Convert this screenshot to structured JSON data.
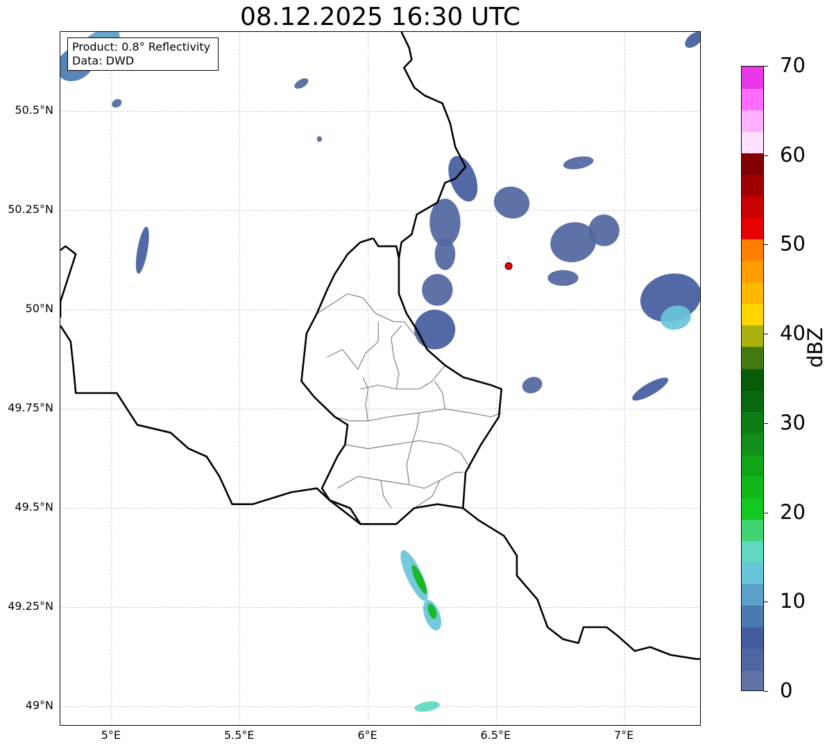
{
  "title": "08.12.2025 16:30 UTC",
  "info_box": {
    "product": "Product: 0.8° Reflectivity",
    "source": "Data: DWD"
  },
  "map": {
    "extent": {
      "lon_min": 4.8,
      "lon_max": 7.3,
      "lat_min": 48.95,
      "lat_max": 50.7
    },
    "gridlines": true,
    "lat_ticks": [
      {
        "value": 50.5,
        "label": "50.5°N"
      },
      {
        "value": 50.25,
        "label": "50.25°N"
      },
      {
        "value": 50.0,
        "label": "50°N"
      },
      {
        "value": 49.75,
        "label": "49.75°N"
      },
      {
        "value": 49.5,
        "label": "49.5°N"
      },
      {
        "value": 49.25,
        "label": "49.25°N"
      },
      {
        "value": 49.0,
        "label": "49°N"
      }
    ],
    "lon_ticks": [
      {
        "value": 5.0,
        "label": "5°E"
      },
      {
        "value": 5.5,
        "label": "5.5°E"
      },
      {
        "value": 6.0,
        "label": "6°E"
      },
      {
        "value": 6.5,
        "label": "6.5°E"
      },
      {
        "value": 7.0,
        "label": "7°E"
      }
    ],
    "radar_site": {
      "lon": 6.548,
      "lat": 50.11,
      "marker_color": "#ee0000"
    },
    "national_borders": [
      [
        [
          6.13,
          50.7
        ],
        [
          6.16,
          50.66
        ],
        [
          6.17,
          50.63
        ],
        [
          6.14,
          50.61
        ],
        [
          6.18,
          50.56
        ],
        [
          6.22,
          50.54
        ],
        [
          6.29,
          50.52
        ],
        [
          6.32,
          50.47
        ],
        [
          6.34,
          50.41
        ],
        [
          6.38,
          50.36
        ],
        [
          6.34,
          50.33
        ],
        [
          6.3,
          50.32
        ],
        [
          6.27,
          50.27
        ],
        [
          6.19,
          50.24
        ],
        [
          6.17,
          50.19
        ],
        [
          6.13,
          50.17
        ],
        [
          6.12,
          50.13
        ],
        [
          6.12,
          50.08
        ],
        [
          6.12,
          50.04
        ],
        [
          6.15,
          49.99
        ],
        [
          6.19,
          49.95
        ],
        [
          6.23,
          49.9
        ],
        [
          6.3,
          49.86
        ],
        [
          6.37,
          49.83
        ],
        [
          6.48,
          49.81
        ],
        [
          6.52,
          49.8
        ],
        [
          6.51,
          49.73
        ],
        [
          6.44,
          49.66
        ],
        [
          6.38,
          49.59
        ],
        [
          6.37,
          49.5
        ],
        [
          6.43,
          49.47
        ],
        [
          6.53,
          49.43
        ],
        [
          6.58,
          49.38
        ],
        [
          6.58,
          49.33
        ],
        [
          6.66,
          49.27
        ],
        [
          6.7,
          49.2
        ],
        [
          6.76,
          49.17
        ],
        [
          6.82,
          49.16
        ],
        [
          6.84,
          49.2
        ],
        [
          6.93,
          49.2
        ],
        [
          6.97,
          49.18
        ],
        [
          7.04,
          49.14
        ],
        [
          7.1,
          49.15
        ],
        [
          7.18,
          49.13
        ],
        [
          7.28,
          49.12
        ],
        [
          7.3,
          49.12
        ]
      ],
      [
        [
          6.37,
          49.5
        ],
        [
          6.27,
          49.51
        ],
        [
          6.18,
          49.5
        ],
        [
          6.11,
          49.46
        ],
        [
          5.97,
          49.46
        ],
        [
          5.93,
          49.5
        ],
        [
          5.85,
          49.52
        ],
        [
          5.8,
          49.55
        ],
        [
          5.7,
          49.54
        ],
        [
          5.55,
          49.51
        ],
        [
          5.47,
          49.51
        ],
        [
          5.42,
          49.58
        ],
        [
          5.37,
          49.63
        ],
        [
          5.3,
          49.65
        ],
        [
          5.23,
          49.69
        ],
        [
          5.1,
          49.71
        ],
        [
          5.02,
          49.79
        ],
        [
          4.92,
          49.79
        ],
        [
          4.86,
          49.79
        ],
        [
          4.85,
          49.86
        ],
        [
          4.84,
          49.92
        ],
        [
          4.8,
          49.96
        ]
      ],
      [
        [
          4.8,
          50.15
        ],
        [
          4.82,
          50.16
        ],
        [
          4.86,
          50.14
        ],
        [
          4.83,
          50.08
        ],
        [
          4.8,
          50.02
        ],
        [
          4.8,
          49.98
        ]
      ],
      [
        [
          6.02,
          50.18
        ],
        [
          5.97,
          50.17
        ],
        [
          5.92,
          50.14
        ],
        [
          5.87,
          50.09
        ],
        [
          5.84,
          50.05
        ],
        [
          5.8,
          49.99
        ],
        [
          5.76,
          49.94
        ],
        [
          5.75,
          49.88
        ],
        [
          5.74,
          49.82
        ],
        [
          5.79,
          49.78
        ],
        [
          5.87,
          49.73
        ],
        [
          5.92,
          49.71
        ],
        [
          5.91,
          49.66
        ],
        [
          5.88,
          49.63
        ],
        [
          5.82,
          49.55
        ],
        [
          5.85,
          49.52
        ],
        [
          5.97,
          49.46
        ]
      ],
      [
        [
          6.02,
          50.18
        ],
        [
          6.04,
          50.16
        ],
        [
          6.11,
          50.16
        ],
        [
          6.12,
          50.13
        ]
      ]
    ],
    "district_borders": [
      [
        [
          5.8,
          49.99
        ],
        [
          5.92,
          50.04
        ],
        [
          5.98,
          50.03
        ],
        [
          6.03,
          49.99
        ],
        [
          6.1,
          49.97
        ],
        [
          6.14,
          49.97
        ],
        [
          6.19,
          49.93
        ]
      ],
      [
        [
          5.84,
          49.88
        ],
        [
          5.9,
          49.9
        ],
        [
          5.96,
          49.85
        ],
        [
          5.99,
          49.89
        ],
        [
          6.04,
          49.92
        ],
        [
          6.04,
          49.97
        ]
      ],
      [
        [
          5.97,
          49.8
        ],
        [
          6.04,
          49.81
        ],
        [
          6.11,
          49.8
        ],
        [
          6.2,
          49.8
        ],
        [
          6.25,
          49.82
        ],
        [
          6.3,
          49.86
        ]
      ],
      [
        [
          5.87,
          49.73
        ],
        [
          5.93,
          49.72
        ],
        [
          6.0,
          49.72
        ],
        [
          6.08,
          49.73
        ],
        [
          6.2,
          49.74
        ],
        [
          6.3,
          49.75
        ],
        [
          6.4,
          49.74
        ],
        [
          6.48,
          49.73
        ],
        [
          6.52,
          49.74
        ]
      ],
      [
        [
          5.91,
          49.66
        ],
        [
          6.0,
          49.65
        ],
        [
          6.1,
          49.66
        ],
        [
          6.2,
          49.67
        ],
        [
          6.3,
          49.66
        ],
        [
          6.36,
          49.64
        ],
        [
          6.4,
          49.6
        ]
      ],
      [
        [
          5.88,
          49.55
        ],
        [
          5.96,
          49.58
        ],
        [
          6.05,
          49.57
        ],
        [
          6.15,
          49.56
        ],
        [
          6.22,
          49.55
        ],
        [
          6.28,
          49.57
        ],
        [
          6.34,
          49.59
        ],
        [
          6.37,
          49.59
        ]
      ],
      [
        [
          6.0,
          49.72
        ],
        [
          5.99,
          49.76
        ],
        [
          6.0,
          49.8
        ],
        [
          5.98,
          49.83
        ]
      ],
      [
        [
          6.11,
          49.8
        ],
        [
          6.12,
          49.84
        ],
        [
          6.1,
          49.88
        ],
        [
          6.09,
          49.93
        ],
        [
          6.13,
          49.96
        ]
      ],
      [
        [
          6.2,
          49.74
        ],
        [
          6.19,
          49.7
        ],
        [
          6.17,
          49.66
        ],
        [
          6.15,
          49.61
        ],
        [
          6.16,
          49.56
        ]
      ],
      [
        [
          6.3,
          49.75
        ],
        [
          6.29,
          49.79
        ],
        [
          6.26,
          49.82
        ]
      ],
      [
        [
          6.05,
          49.57
        ],
        [
          6.06,
          49.53
        ],
        [
          6.09,
          49.5
        ]
      ],
      [
        [
          6.28,
          49.57
        ],
        [
          6.25,
          49.53
        ],
        [
          6.18,
          49.5
        ]
      ]
    ],
    "echoes": [
      {
        "lon": 4.86,
        "lat": 50.62,
        "rx": 0.08,
        "ry": 0.04,
        "dbz": 8,
        "rot": -35
      },
      {
        "lon": 4.95,
        "lat": 50.67,
        "rx": 0.09,
        "ry": 0.03,
        "dbz": 10,
        "rot": -30
      },
      {
        "lon": 5.12,
        "lat": 50.15,
        "rx": 0.02,
        "ry": 0.06,
        "dbz": 6,
        "rot": 10
      },
      {
        "lon": 5.74,
        "lat": 50.57,
        "rx": 0.03,
        "ry": 0.01,
        "dbz": 4,
        "rot": -30
      },
      {
        "lon": 5.02,
        "lat": 50.52,
        "rx": 0.02,
        "ry": 0.01,
        "dbz": 4,
        "rot": -30
      },
      {
        "lon": 5.81,
        "lat": 50.43,
        "rx": 0.01,
        "ry": 0.007,
        "dbz": 3,
        "rot": 0
      },
      {
        "lon": 6.37,
        "lat": 50.33,
        "rx": 0.05,
        "ry": 0.06,
        "dbz": 5,
        "rot": -20
      },
      {
        "lon": 6.3,
        "lat": 50.22,
        "rx": 0.06,
        "ry": 0.06,
        "dbz": 4,
        "rot": 0
      },
      {
        "lon": 6.3,
        "lat": 50.14,
        "rx": 0.04,
        "ry": 0.04,
        "dbz": 4,
        "rot": 0
      },
      {
        "lon": 6.27,
        "lat": 50.05,
        "rx": 0.06,
        "ry": 0.04,
        "dbz": 4,
        "rot": 0
      },
      {
        "lon": 6.26,
        "lat": 49.95,
        "rx": 0.08,
        "ry": 0.05,
        "dbz": 5,
        "rot": 0
      },
      {
        "lon": 6.56,
        "lat": 50.27,
        "rx": 0.07,
        "ry": 0.04,
        "dbz": 4,
        "rot": 15
      },
      {
        "lon": 6.8,
        "lat": 50.17,
        "rx": 0.09,
        "ry": 0.05,
        "dbz": 4,
        "rot": -15
      },
      {
        "lon": 6.92,
        "lat": 50.2,
        "rx": 0.06,
        "ry": 0.04,
        "dbz": 4,
        "rot": -10
      },
      {
        "lon": 6.82,
        "lat": 50.37,
        "rx": 0.06,
        "ry": 0.015,
        "dbz": 3,
        "rot": -10
      },
      {
        "lon": 6.76,
        "lat": 50.08,
        "rx": 0.06,
        "ry": 0.02,
        "dbz": 3,
        "rot": 0
      },
      {
        "lon": 7.18,
        "lat": 50.03,
        "rx": 0.12,
        "ry": 0.06,
        "dbz": 7,
        "rot": -15
      },
      {
        "lon": 7.2,
        "lat": 49.98,
        "rx": 0.06,
        "ry": 0.03,
        "dbz": 14,
        "rot": -15
      },
      {
        "lon": 7.1,
        "lat": 49.8,
        "rx": 0.08,
        "ry": 0.015,
        "dbz": 7,
        "rot": -30
      },
      {
        "lon": 6.64,
        "lat": 49.81,
        "rx": 0.04,
        "ry": 0.02,
        "dbz": 3,
        "rot": -20
      },
      {
        "lon": 7.27,
        "lat": 50.68,
        "rx": 0.04,
        "ry": 0.015,
        "dbz": 6,
        "rot": -40
      },
      {
        "lon": 6.18,
        "lat": 49.33,
        "rx": 0.03,
        "ry": 0.07,
        "dbz": 14,
        "rot": -25
      },
      {
        "lon": 6.2,
        "lat": 49.32,
        "rx": 0.015,
        "ry": 0.04,
        "dbz": 24,
        "rot": -25
      },
      {
        "lon": 6.25,
        "lat": 49.23,
        "rx": 0.03,
        "ry": 0.04,
        "dbz": 14,
        "rot": -20
      },
      {
        "lon": 6.25,
        "lat": 49.24,
        "rx": 0.015,
        "ry": 0.02,
        "dbz": 22,
        "rot": -20
      },
      {
        "lon": 6.23,
        "lat": 49.0,
        "rx": 0.05,
        "ry": 0.012,
        "dbz": 15,
        "rot": -10
      }
    ]
  },
  "colorbar": {
    "label": "dBZ",
    "min": 0,
    "max": 70,
    "ticks": [
      {
        "value": 0,
        "label": "0"
      },
      {
        "value": 10,
        "label": "10"
      },
      {
        "value": 20,
        "label": "20"
      },
      {
        "value": 30,
        "label": "30"
      },
      {
        "value": 40,
        "label": "40"
      },
      {
        "value": 50,
        "label": "50"
      },
      {
        "value": 60,
        "label": "60"
      },
      {
        "value": 70,
        "label": "70"
      }
    ],
    "colors": [
      "#6074a8",
      "#5066a0",
      "#445c9e",
      "#4a7ab0",
      "#5aa0c8",
      "#68c4d8",
      "#60d8c0",
      "#40d470",
      "#10c820",
      "#10b818",
      "#10a418",
      "#109018",
      "#0c7c14",
      "#0a6810",
      "#065a08",
      "#447810",
      "#aab00c",
      "#ffd600",
      "#ffb800",
      "#ff9c00",
      "#ff8000",
      "#e60000",
      "#c80000",
      "#a00000",
      "#800000",
      "#ffe0ff",
      "#ffb0ff",
      "#ff6cff",
      "#e838e8"
    ]
  }
}
